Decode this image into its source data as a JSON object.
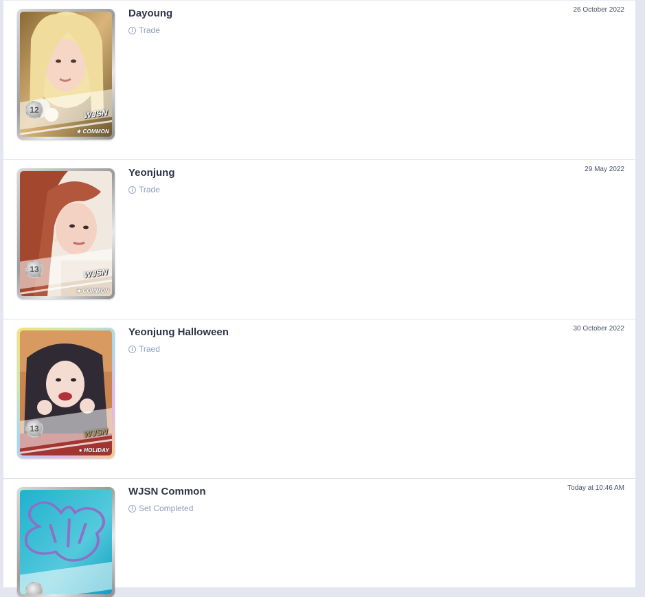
{
  "feed": [
    {
      "title": "Dayoung",
      "subtitle": "Trade",
      "date": "26 October 2022",
      "card": {
        "level": "12",
        "group": "WJSN",
        "rarity": "COMMON"
      }
    },
    {
      "title": "Yeonjung",
      "subtitle": "Trade",
      "date": "29 May 2022",
      "card": {
        "level": "13",
        "group": "WJSN",
        "rarity": "COMMON"
      }
    },
    {
      "title": "Yeonjung Halloween",
      "subtitle": "Traed",
      "date": "30 October 2022",
      "card": {
        "level": "13",
        "group": "WJSN",
        "rarity": "HOLIDAY"
      }
    },
    {
      "title": "WJSN Common",
      "subtitle": "Set Completed",
      "date": "Today at 10:46 AM",
      "card": {
        "level": "",
        "group": "",
        "rarity": ""
      }
    }
  ],
  "icons": {
    "info": "info-circle-icon"
  },
  "colors": {
    "title": "#2f3546",
    "subtitle": "#8e9cb8",
    "divider": "#dde1e8",
    "background": "#e3e6ef"
  }
}
